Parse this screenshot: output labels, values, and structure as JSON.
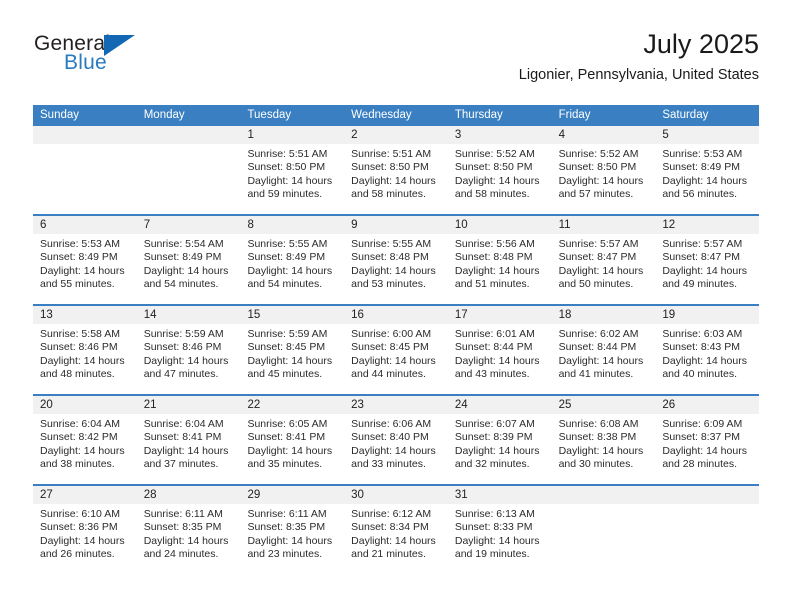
{
  "brand": {
    "line1": "General",
    "line2": "Blue",
    "triangle_icon": "brand-triangle-icon",
    "blue": "#1268b3"
  },
  "header": {
    "title": "July 2025",
    "subtitle": "Ligonier, Pennsylvania, United States"
  },
  "theme": {
    "header_blue": "#3a7fc1",
    "band_gray": "#f1f1f1",
    "text": "#2b2b2b"
  },
  "weekdays": [
    "Sunday",
    "Monday",
    "Tuesday",
    "Wednesday",
    "Thursday",
    "Friday",
    "Saturday"
  ],
  "weeks": [
    [
      {
        "day": ""
      },
      {
        "day": ""
      },
      {
        "day": "1",
        "sunrise": "Sunrise: 5:51 AM",
        "sunset": "Sunset: 8:50 PM",
        "daylight": "Daylight: 14 hours and 59 minutes."
      },
      {
        "day": "2",
        "sunrise": "Sunrise: 5:51 AM",
        "sunset": "Sunset: 8:50 PM",
        "daylight": "Daylight: 14 hours and 58 minutes."
      },
      {
        "day": "3",
        "sunrise": "Sunrise: 5:52 AM",
        "sunset": "Sunset: 8:50 PM",
        "daylight": "Daylight: 14 hours and 58 minutes."
      },
      {
        "day": "4",
        "sunrise": "Sunrise: 5:52 AM",
        "sunset": "Sunset: 8:50 PM",
        "daylight": "Daylight: 14 hours and 57 minutes."
      },
      {
        "day": "5",
        "sunrise": "Sunrise: 5:53 AM",
        "sunset": "Sunset: 8:49 PM",
        "daylight": "Daylight: 14 hours and 56 minutes."
      }
    ],
    [
      {
        "day": "6",
        "sunrise": "Sunrise: 5:53 AM",
        "sunset": "Sunset: 8:49 PM",
        "daylight": "Daylight: 14 hours and 55 minutes."
      },
      {
        "day": "7",
        "sunrise": "Sunrise: 5:54 AM",
        "sunset": "Sunset: 8:49 PM",
        "daylight": "Daylight: 14 hours and 54 minutes."
      },
      {
        "day": "8",
        "sunrise": "Sunrise: 5:55 AM",
        "sunset": "Sunset: 8:49 PM",
        "daylight": "Daylight: 14 hours and 54 minutes."
      },
      {
        "day": "9",
        "sunrise": "Sunrise: 5:55 AM",
        "sunset": "Sunset: 8:48 PM",
        "daylight": "Daylight: 14 hours and 53 minutes."
      },
      {
        "day": "10",
        "sunrise": "Sunrise: 5:56 AM",
        "sunset": "Sunset: 8:48 PM",
        "daylight": "Daylight: 14 hours and 51 minutes."
      },
      {
        "day": "11",
        "sunrise": "Sunrise: 5:57 AM",
        "sunset": "Sunset: 8:47 PM",
        "daylight": "Daylight: 14 hours and 50 minutes."
      },
      {
        "day": "12",
        "sunrise": "Sunrise: 5:57 AM",
        "sunset": "Sunset: 8:47 PM",
        "daylight": "Daylight: 14 hours and 49 minutes."
      }
    ],
    [
      {
        "day": "13",
        "sunrise": "Sunrise: 5:58 AM",
        "sunset": "Sunset: 8:46 PM",
        "daylight": "Daylight: 14 hours and 48 minutes."
      },
      {
        "day": "14",
        "sunrise": "Sunrise: 5:59 AM",
        "sunset": "Sunset: 8:46 PM",
        "daylight": "Daylight: 14 hours and 47 minutes."
      },
      {
        "day": "15",
        "sunrise": "Sunrise: 5:59 AM",
        "sunset": "Sunset: 8:45 PM",
        "daylight": "Daylight: 14 hours and 45 minutes."
      },
      {
        "day": "16",
        "sunrise": "Sunrise: 6:00 AM",
        "sunset": "Sunset: 8:45 PM",
        "daylight": "Daylight: 14 hours and 44 minutes."
      },
      {
        "day": "17",
        "sunrise": "Sunrise: 6:01 AM",
        "sunset": "Sunset: 8:44 PM",
        "daylight": "Daylight: 14 hours and 43 minutes."
      },
      {
        "day": "18",
        "sunrise": "Sunrise: 6:02 AM",
        "sunset": "Sunset: 8:44 PM",
        "daylight": "Daylight: 14 hours and 41 minutes."
      },
      {
        "day": "19",
        "sunrise": "Sunrise: 6:03 AM",
        "sunset": "Sunset: 8:43 PM",
        "daylight": "Daylight: 14 hours and 40 minutes."
      }
    ],
    [
      {
        "day": "20",
        "sunrise": "Sunrise: 6:04 AM",
        "sunset": "Sunset: 8:42 PM",
        "daylight": "Daylight: 14 hours and 38 minutes."
      },
      {
        "day": "21",
        "sunrise": "Sunrise: 6:04 AM",
        "sunset": "Sunset: 8:41 PM",
        "daylight": "Daylight: 14 hours and 37 minutes."
      },
      {
        "day": "22",
        "sunrise": "Sunrise: 6:05 AM",
        "sunset": "Sunset: 8:41 PM",
        "daylight": "Daylight: 14 hours and 35 minutes."
      },
      {
        "day": "23",
        "sunrise": "Sunrise: 6:06 AM",
        "sunset": "Sunset: 8:40 PM",
        "daylight": "Daylight: 14 hours and 33 minutes."
      },
      {
        "day": "24",
        "sunrise": "Sunrise: 6:07 AM",
        "sunset": "Sunset: 8:39 PM",
        "daylight": "Daylight: 14 hours and 32 minutes."
      },
      {
        "day": "25",
        "sunrise": "Sunrise: 6:08 AM",
        "sunset": "Sunset: 8:38 PM",
        "daylight": "Daylight: 14 hours and 30 minutes."
      },
      {
        "day": "26",
        "sunrise": "Sunrise: 6:09 AM",
        "sunset": "Sunset: 8:37 PM",
        "daylight": "Daylight: 14 hours and 28 minutes."
      }
    ],
    [
      {
        "day": "27",
        "sunrise": "Sunrise: 6:10 AM",
        "sunset": "Sunset: 8:36 PM",
        "daylight": "Daylight: 14 hours and 26 minutes."
      },
      {
        "day": "28",
        "sunrise": "Sunrise: 6:11 AM",
        "sunset": "Sunset: 8:35 PM",
        "daylight": "Daylight: 14 hours and 24 minutes."
      },
      {
        "day": "29",
        "sunrise": "Sunrise: 6:11 AM",
        "sunset": "Sunset: 8:35 PM",
        "daylight": "Daylight: 14 hours and 23 minutes."
      },
      {
        "day": "30",
        "sunrise": "Sunrise: 6:12 AM",
        "sunset": "Sunset: 8:34 PM",
        "daylight": "Daylight: 14 hours and 21 minutes."
      },
      {
        "day": "31",
        "sunrise": "Sunrise: 6:13 AM",
        "sunset": "Sunset: 8:33 PM",
        "daylight": "Daylight: 14 hours and 19 minutes."
      },
      {
        "day": ""
      },
      {
        "day": ""
      }
    ]
  ]
}
